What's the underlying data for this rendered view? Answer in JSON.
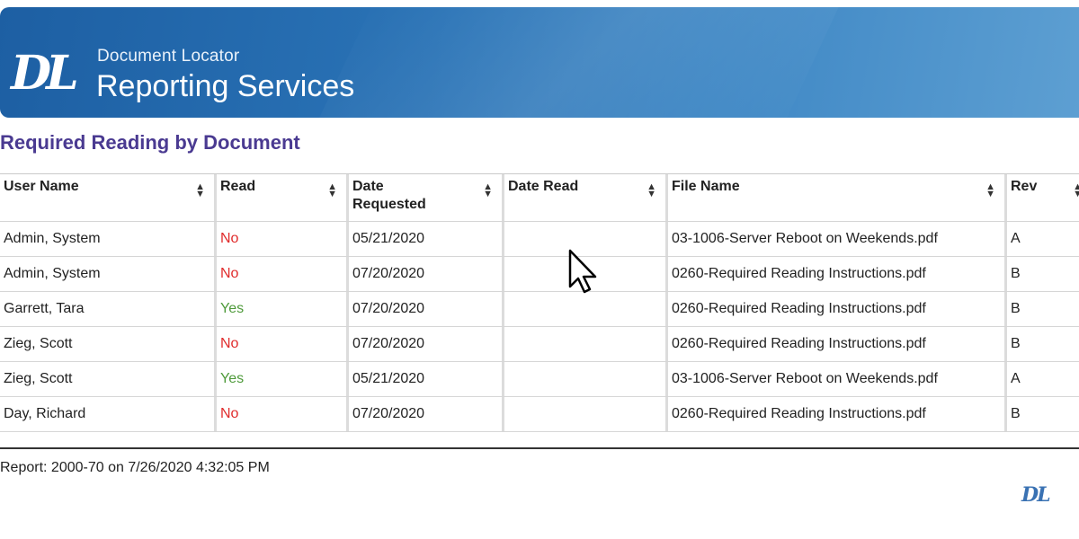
{
  "header": {
    "logo_text": "DL",
    "brand_small": "Document Locator",
    "brand_large": "Reporting Services"
  },
  "report": {
    "title": "Required Reading by Document",
    "columns": [
      "User Name",
      "Read",
      "Date Requested",
      "Date Read",
      "File Name",
      "Rev"
    ],
    "rows": [
      {
        "user": "Admin, System",
        "read": "No",
        "date_requested": "05/21/2020",
        "date_read": "",
        "file": "03-1006-Server Reboot on Weekends.pdf",
        "rev": "A"
      },
      {
        "user": "Admin, System",
        "read": "No",
        "date_requested": "07/20/2020",
        "date_read": "",
        "file": "0260-Required Reading Instructions.pdf",
        "rev": "B"
      },
      {
        "user": "Garrett, Tara",
        "read": "Yes",
        "date_requested": "07/20/2020",
        "date_read": "",
        "file": "0260-Required Reading Instructions.pdf",
        "rev": "B"
      },
      {
        "user": "Zieg, Scott",
        "read": "No",
        "date_requested": "07/20/2020",
        "date_read": "",
        "file": "0260-Required Reading Instructions.pdf",
        "rev": "B"
      },
      {
        "user": "Zieg, Scott",
        "read": "Yes",
        "date_requested": "05/21/2020",
        "date_read": "",
        "file": "03-1006-Server Reboot on Weekends.pdf",
        "rev": "A"
      },
      {
        "user": "Day, Richard",
        "read": "No",
        "date_requested": "07/20/2020",
        "date_read": "",
        "file": "0260-Required Reading Instructions.pdf",
        "rev": "B"
      }
    ]
  },
  "footer": {
    "report_info": "Report: 2000-70 on 7/26/2020 4:32:05 PM",
    "logo_text": "DL"
  },
  "colors": {
    "banner": "#2a73b6",
    "title": "#4a3a91",
    "no": "#e02b2b",
    "yes": "#4e9a3a"
  },
  "icons": {
    "sort": "sort-icon",
    "cursor": "mouse-cursor-icon"
  }
}
